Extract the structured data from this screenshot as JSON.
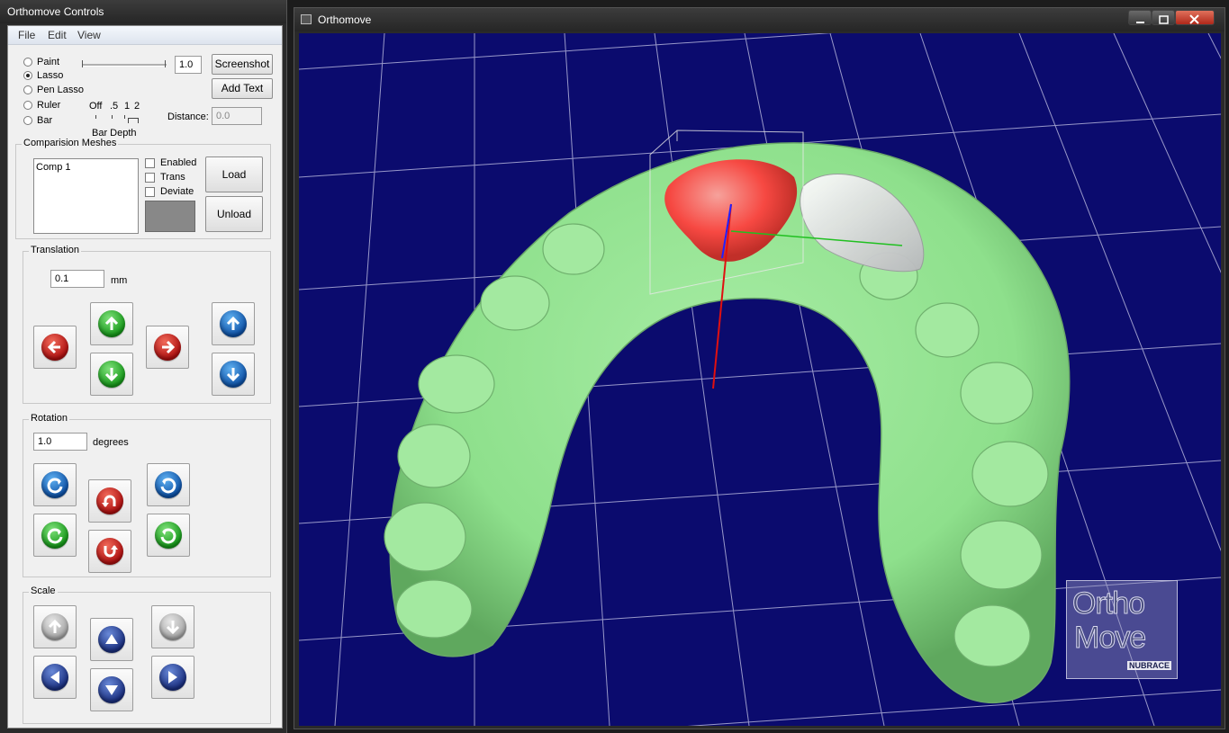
{
  "controls_window": {
    "title": "Orthomove Controls",
    "menu": [
      "File",
      "Edit",
      "View"
    ],
    "tools": [
      {
        "label": "Paint",
        "selected": false
      },
      {
        "label": "Lasso",
        "selected": true
      },
      {
        "label": "Pen Lasso",
        "selected": false
      },
      {
        "label": "Ruler",
        "selected": false
      },
      {
        "label": "Bar",
        "selected": false
      }
    ],
    "brush_value": "1.0",
    "screenshot_label": "Screenshot",
    "add_text_label": "Add Text",
    "bar_depth_ticks": [
      "Off",
      ".5",
      "1",
      "2"
    ],
    "bar_depth_label": "Bar Depth",
    "distance_label": "Distance:",
    "distance_value": "0.0",
    "comparison": {
      "title": "Comparision Meshes",
      "items": [
        "Comp 1"
      ],
      "enabled_label": "Enabled",
      "trans_label": "Trans",
      "deviate_label": "Deviate",
      "load_label": "Load",
      "unload_label": "Unload",
      "swatch_color": "#888888"
    },
    "translation": {
      "title": "Translation",
      "value": "0.1",
      "unit": "mm"
    },
    "rotation": {
      "title": "Rotation",
      "value": "1.0",
      "unit": "degrees"
    },
    "scale": {
      "title": "Scale"
    }
  },
  "main_window": {
    "title": "Orthomove",
    "logo_line1": "Ortho",
    "logo_line2": "Move",
    "logo_brand": "NUBRACE",
    "colors": {
      "background": "#0b0b6e",
      "grid": "#c8c8e8",
      "mesh": "#8ee08c",
      "highlight": "#ff3b3b",
      "selected_tooth": "#e8e8ea"
    }
  }
}
